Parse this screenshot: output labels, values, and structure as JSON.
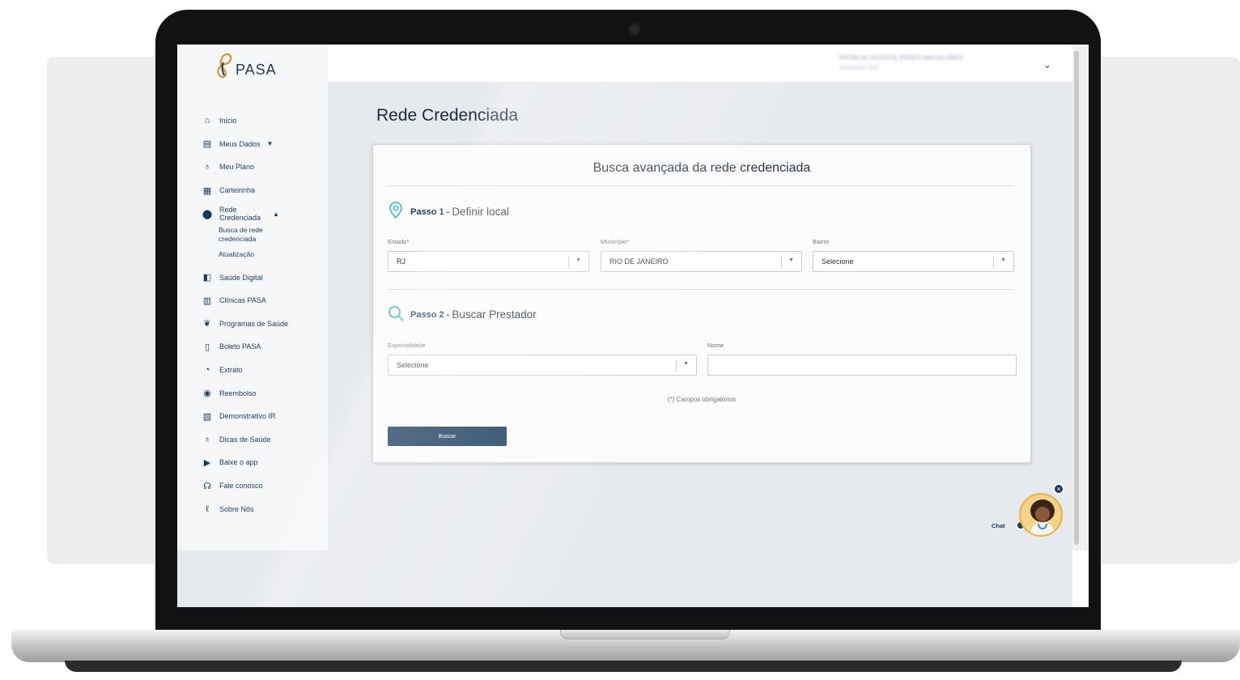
{
  "app": {
    "logo_text": "PASA"
  },
  "sidebar": {
    "items": [
      {
        "label": "Início",
        "icon": "home-icon",
        "glyph": "⌂"
      },
      {
        "label": "Meus Dados",
        "icon": "id-card-icon",
        "glyph": "▤",
        "caret": "▼"
      },
      {
        "label": "Meu Plano",
        "icon": "stethoscope-icon",
        "glyph": "♁"
      },
      {
        "label": "Carteirinha",
        "icon": "card-icon",
        "glyph": "▦"
      },
      {
        "label": "Rede Credenciada",
        "icon": "location-pin-icon",
        "glyph": "⬤",
        "caret": "▲"
      },
      {
        "label": "Saúde Digital",
        "icon": "phone-health-icon",
        "glyph": "◧"
      },
      {
        "label": "Clínicas PASA",
        "icon": "building-icon",
        "glyph": "▥"
      },
      {
        "label": "Programas de Saúde",
        "icon": "health-program-icon",
        "glyph": "❦"
      },
      {
        "label": "Boleto PASA",
        "icon": "barcode-icon",
        "glyph": "▯"
      },
      {
        "label": "Extrato",
        "icon": "clock-icon",
        "glyph": "◔"
      },
      {
        "label": "Reembolso",
        "icon": "piggy-bank-icon",
        "glyph": "◉"
      },
      {
        "label": "Demonstrativo IR",
        "icon": "document-icon",
        "glyph": "▧"
      },
      {
        "label": "Dicas de Saúde",
        "icon": "stethoscope-tip-icon",
        "glyph": "♁"
      },
      {
        "label": "Baixe o app",
        "icon": "download-app-icon",
        "glyph": "▶"
      },
      {
        "label": "Fale conosco",
        "icon": "headset-icon",
        "glyph": "☊"
      },
      {
        "label": "Sobre Nós",
        "icon": "pasa-logo-icon",
        "glyph": "ℓ"
      }
    ],
    "subitems": [
      {
        "label": "Busca de rede credenciada"
      },
      {
        "label": "Atualização"
      }
    ]
  },
  "header": {
    "user_name": "PATRICIA VICENTE PERES MAGALHÃES",
    "user_sub": "XXXXXXX XXX"
  },
  "main": {
    "title": "Rede Credenciada",
    "card_title": "Busca avançada da rede credenciada",
    "step1": {
      "bold": "Passo 1 -",
      "text": "Definir local"
    },
    "step2": {
      "bold": "Passo 2 -",
      "text": "Buscar Prestador"
    },
    "fields": {
      "estado": {
        "label": "Estado*",
        "value": "RJ"
      },
      "municipio": {
        "label": "Município*",
        "value": "RIO DE JANEIRO"
      },
      "bairro": {
        "label": "Bairro",
        "value": "Selecione"
      },
      "especialidade": {
        "label": "Especialidade",
        "value": "Selecione"
      },
      "nome": {
        "label": "Nome",
        "value": ""
      }
    },
    "required_note": "(*) Campos obrigatórios",
    "search_button": "Buscar"
  },
  "chat": {
    "label": "Chat",
    "close": "×"
  },
  "colors": {
    "brand_navy": "#1a3a5c",
    "logo_gold": "#c99a2e",
    "pin_teal": "#49b6c7"
  }
}
